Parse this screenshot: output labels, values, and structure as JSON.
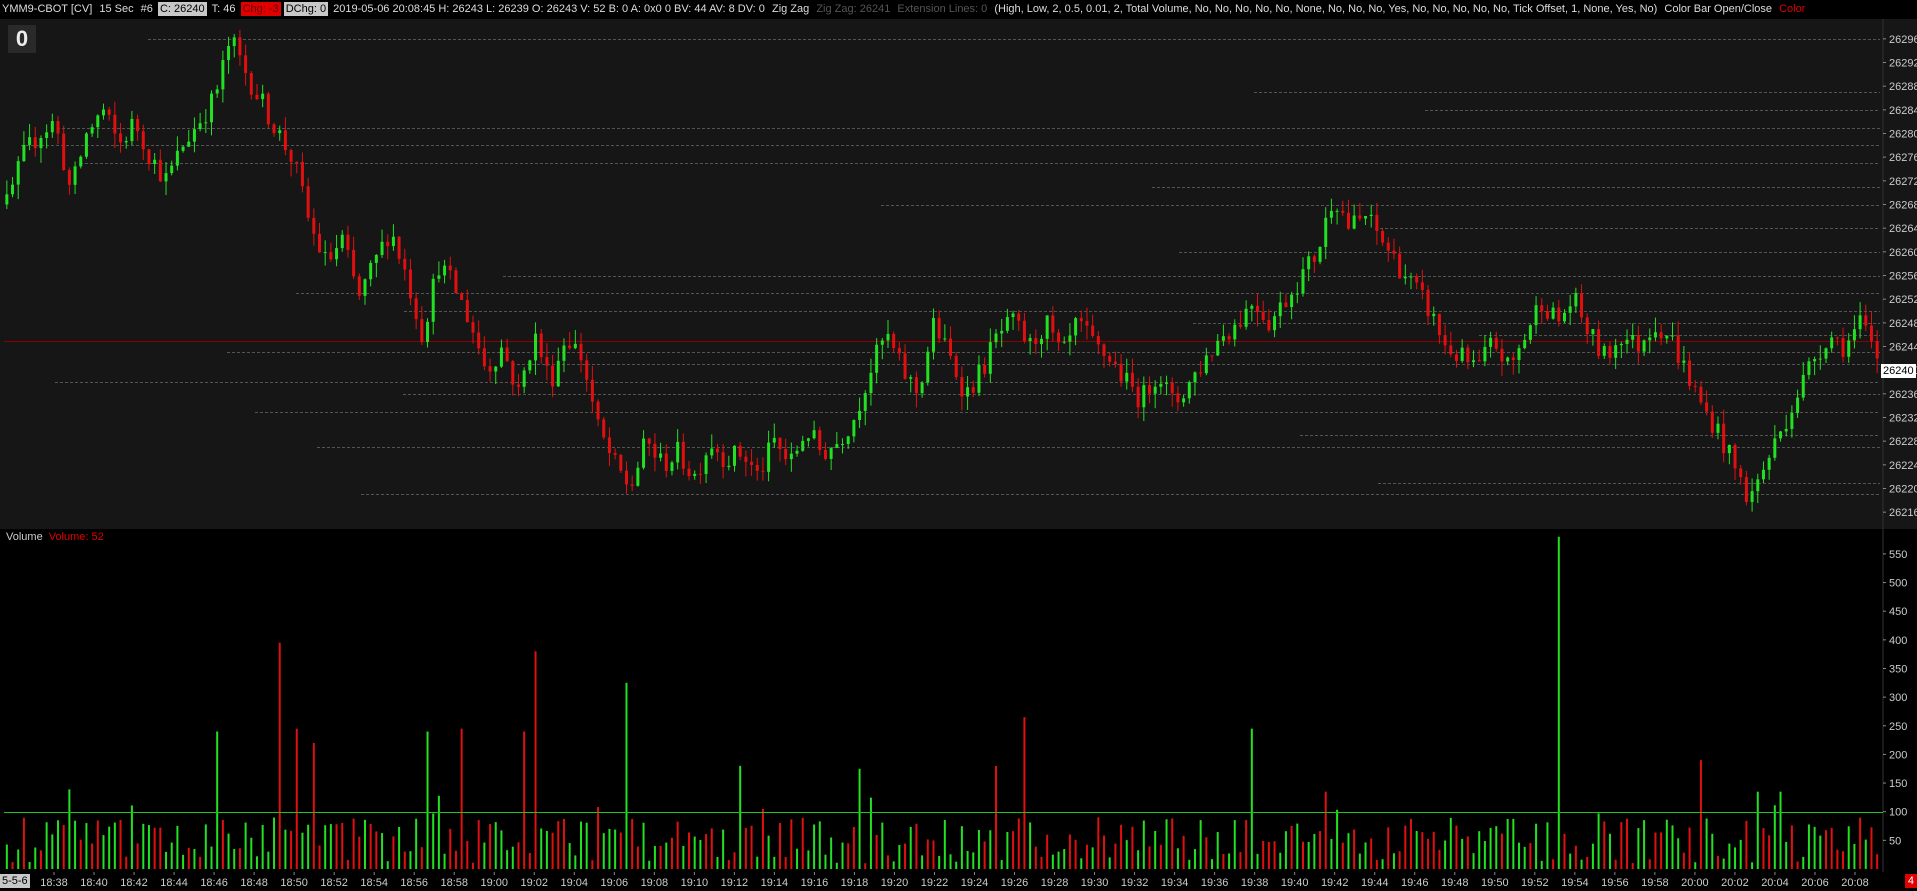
{
  "header": {
    "symbol": "YMM9-CBOT [CV]",
    "interval": "15 Sec",
    "chart_num": "#6",
    "close_box": "C: 26240",
    "ticks": "T: 46",
    "chg_box": "Chg: -3",
    "dchg_box": "DChg: 0",
    "stats": "2019-05-06 20:08:45 H: 26243 L: 26239 O: 26243 V: 52 B: 0 A: 0x0 0 BV: 44 AV: 8 DV: 0",
    "study1": "Zig Zag",
    "study1_val": "Zig Zag: 26241",
    "study2": "Extension Lines: 0",
    "params": "(High, Low, 2, 0.5, 0.01, 2, Total Volume, No, No, No, No, No, None, No, No, No, Yes, No, No, No, No, No, Tick Offset, 1, None, Yes, No)",
    "study3": "Color Bar Open/Close",
    "study3_val": "Color"
  },
  "badge": "0",
  "volume_pane": {
    "label": "Volume",
    "value_label": "Volume: 52"
  },
  "current_price": "26240",
  "date_tag": "5-5-6",
  "right_tag": "4",
  "colors": {
    "up": "#22e022",
    "down": "#e01010",
    "bg_price": "#161616",
    "bg_volume": "#000000",
    "grid_dashed": "#555555",
    "price_line": "#8b0000",
    "vol_ref": "#22c022"
  },
  "chart_data": [
    {
      "type": "candlestick",
      "y_ticks": [
        "26296",
        "26292",
        "26288",
        "26284",
        "26280",
        "26276",
        "26272",
        "26268",
        "26264",
        "26260",
        "26256",
        "26252",
        "26248",
        "26244",
        "26240",
        "26236",
        "26232",
        "26228",
        "26224",
        "26220",
        "26216"
      ],
      "ylim": [
        26214,
        26298
      ],
      "horizontal_line": 26245,
      "extension_levels": [
        26296,
        26287,
        26284,
        26281,
        26278,
        26275,
        26271,
        26268,
        26264,
        26260,
        26256,
        26253,
        26250,
        26248,
        26246,
        26243,
        26241,
        26238,
        26236,
        26233,
        26229,
        26227,
        26221,
        26219
      ],
      "x_ticks": [
        "18:38",
        "18:40",
        "18:42",
        "18:44",
        "18:46",
        "18:48",
        "18:50",
        "18:52",
        "18:54",
        "18:56",
        "18:58",
        "19:00",
        "19:02",
        "19:04",
        "19:06",
        "19:08",
        "19:10",
        "19:12",
        "19:14",
        "19:16",
        "19:18",
        "19:20",
        "19:22",
        "19:24",
        "19:26",
        "19:28",
        "19:30",
        "19:32",
        "19:34",
        "19:36",
        "19:38",
        "19:40",
        "19:42",
        "19:44",
        "19:46",
        "19:48",
        "19:50",
        "19:52",
        "19:54",
        "19:56",
        "19:58",
        "20:00",
        "20:02",
        "20:04",
        "20:06",
        "20:08"
      ],
      "close_path": [
        26268,
        26276,
        26280,
        26282,
        26270,
        26280,
        26284,
        26278,
        26282,
        26276,
        26272,
        26278,
        26282,
        26286,
        26296,
        26290,
        26285,
        26280,
        26275,
        26264,
        26258,
        26262,
        26252,
        26258,
        26264,
        26256,
        26246,
        26258,
        26254,
        26248,
        26240,
        26244,
        26236,
        26246,
        26238,
        26246,
        26242,
        26230,
        26224,
        26220,
        26228,
        26224,
        26226,
        26222,
        26228,
        26225,
        26226,
        26222,
        26228,
        26224,
        26230,
        26226,
        26228,
        26232,
        26240,
        26246,
        26240,
        26236,
        26248,
        26242,
        26236,
        26240,
        26246,
        26248,
        26244,
        26248,
        26242,
        26248,
        26244,
        26242,
        26238,
        26235,
        26240,
        26234,
        26238,
        26242,
        26246,
        26248,
        26252,
        26248,
        26252,
        26256,
        26260,
        26270,
        26264,
        26266,
        26262,
        26258,
        26254,
        26250,
        26244,
        26242,
        26240,
        26245,
        26240,
        26246,
        26252,
        26248,
        26252,
        26246,
        26242,
        26246,
        26244,
        26248,
        26246,
        26240,
        26234,
        26230,
        26224,
        26218,
        26224,
        26230,
        26236,
        26242,
        26246,
        26244,
        26248,
        26242
      ]
    },
    {
      "type": "bar",
      "title": "Volume",
      "y_ticks": [
        "550",
        "500",
        "450",
        "400",
        "350",
        "300",
        "250",
        "200",
        "150",
        "100",
        "50"
      ],
      "ylim": [
        0,
        590
      ],
      "reference_line": 100,
      "x_ticks": [
        "18:38",
        "18:40",
        "18:42",
        "18:44",
        "18:46",
        "18:48",
        "18:50",
        "18:52",
        "18:54",
        "18:56",
        "18:58",
        "19:00",
        "19:02",
        "19:04",
        "19:06",
        "19:08",
        "19:10",
        "19:12",
        "19:14",
        "19:16",
        "19:18",
        "19:20",
        "19:22",
        "19:24",
        "19:26",
        "19:28",
        "19:30",
        "19:32",
        "19:34",
        "19:36",
        "19:38",
        "19:40",
        "19:42",
        "19:44",
        "19:46",
        "19:48",
        "19:50",
        "19:52",
        "19:54",
        "19:56",
        "19:58",
        "20:00",
        "20:02",
        "20:04",
        "20:06",
        "20:08"
      ],
      "spikes": [
        [
          0.145,
          395,
          "down"
        ],
        [
          0.283,
          380,
          "down"
        ],
        [
          0.33,
          325,
          "up"
        ],
        [
          0.544,
          265,
          "down"
        ],
        [
          0.665,
          245,
          "up"
        ],
        [
          0.829,
          580,
          "up"
        ],
        [
          0.906,
          190,
          "down"
        ],
        [
          0.225,
          240,
          "up"
        ],
        [
          0.112,
          240,
          "up"
        ],
        [
          0.154,
          245,
          "down"
        ],
        [
          0.164,
          220,
          "down"
        ],
        [
          0.242,
          245,
          "down"
        ],
        [
          0.278,
          240,
          "down"
        ],
        [
          0.53,
          180,
          "down"
        ],
        [
          0.391,
          180,
          "up"
        ],
        [
          0.457,
          175,
          "up"
        ],
        [
          0.706,
          135,
          "down"
        ],
        [
          0.937,
          135,
          "up"
        ],
        [
          0.949,
          135,
          "up"
        ]
      ]
    }
  ]
}
